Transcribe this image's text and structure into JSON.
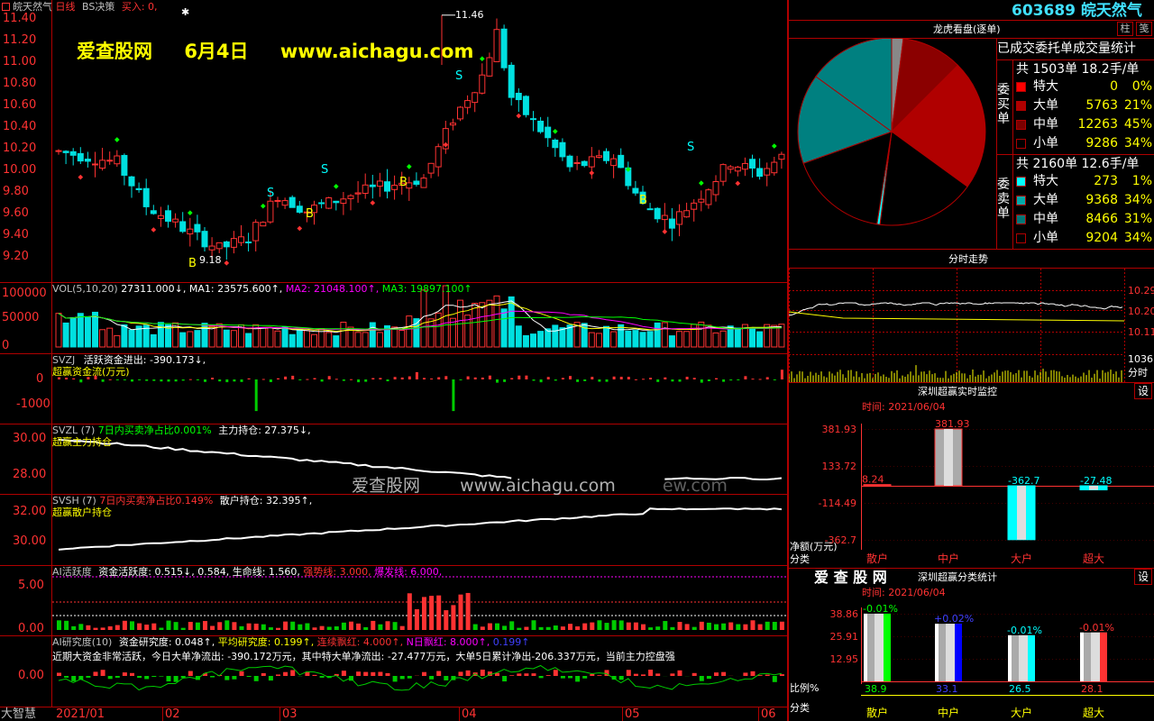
{
  "header": {
    "stock_name": "皖天然气",
    "period": "日线",
    "strategy": "BS决策",
    "signal_text": "买入: 0,",
    "code_name": "603689 皖天然气",
    "btn_zhu": "柱",
    "btn_jian": "笺"
  },
  "watermark": {
    "site": "爱查股网",
    "date": "6月4日",
    "url": "www.aichagu.com",
    "mid_site": "爱查股网",
    "mid_url": "www.aichagu.com",
    "mid_tail": "ew.com"
  },
  "price_axis": [
    "11.40",
    "11.20",
    "11.00",
    "10.80",
    "10.60",
    "10.40",
    "10.20",
    "10.00",
    "9.80",
    "9.60",
    "9.40",
    "9.20"
  ],
  "price_marks": {
    "high": "11.46",
    "low": "9.18"
  },
  "signals": {
    "s": "S",
    "b": "B"
  },
  "vol": {
    "axis": [
      "100000",
      "50000",
      "0"
    ],
    "label": "VOL(5,10,20)",
    "value": "27311.000↓,",
    "ma1": "MA1: 23575.600↑,",
    "ma2": "MA2: 21048.100↑,",
    "ma3": "MA3: 19897.100↑"
  },
  "svzj": {
    "axis": [
      "0",
      "-1000"
    ],
    "label": "SVZJ",
    "text": "活跃资金进出: -390.173↓,",
    "sub": "超赢资金流(万元)"
  },
  "svzl": {
    "axis": [
      "30.00",
      "28.00"
    ],
    "label": "SVZL (7)",
    "ratio": "7日内买卖净占比0.001%",
    "hold": "主力持仓: 27.375↓,",
    "sub": "超赢主力持仓"
  },
  "svsh": {
    "axis": [
      "32.00",
      "30.00"
    ],
    "label": "SVSH (7)",
    "ratio": "7日内买卖净占比0.149%",
    "hold": "散户持仓: 32.395↑,",
    "sub": "超赢散户持仓"
  },
  "ai_active": {
    "axis": [
      "5.00",
      "0.00"
    ],
    "label": "AI活跃度",
    "v1": "资金活跃度: 0.515↓,",
    "v2": "0.584,",
    "v3": "生命线: 1.560,",
    "v4": "强势线: 3.000,",
    "v5": "爆发线: 6.000,"
  },
  "ai_research": {
    "axis": [
      "0.00"
    ],
    "label": "AI研究度(10)",
    "v1": "资金研究度: 0.048↑,",
    "v2": "平均研究度: 0.199↑,",
    "v3": "连续飘红: 4.000↑,",
    "v4": "N日飘红: 8.000↑,",
    "v5": "0.199↑",
    "summary": "近期大资金非常活跃，今日大单净流出: -390.172万元，其中特大单净流出: -27.477万元，大单5日累计净出-206.337万元，当前主力控盘强"
  },
  "bottom": {
    "brand": "大智慧",
    "dates": [
      "2021/01",
      "02",
      "03",
      "04",
      "05",
      "06"
    ]
  },
  "longhu": {
    "title": "龙虎看盘(逐单)",
    "subtitle": "已成交委托单成交量统计",
    "buy_label": "委买单",
    "sell_label": "委卖单",
    "buy_total": "共 1503单 18.2手/单",
    "sell_total": "共 2160单 12.6手/单",
    "buy_rows": [
      {
        "name": "特大",
        "count": "0",
        "pct": "0%",
        "color": "#ff0000"
      },
      {
        "name": "大单",
        "count": "5763",
        "pct": "21%",
        "color": "#b00000"
      },
      {
        "name": "中单",
        "count": "12263",
        "pct": "45%",
        "color": "#7a0000"
      },
      {
        "name": "小单",
        "count": "9286",
        "pct": "34%",
        "color": "#000000"
      }
    ],
    "sell_rows": [
      {
        "name": "特大",
        "count": "273",
        "pct": "1%",
        "color": "#00ffff"
      },
      {
        "name": "大单",
        "count": "9368",
        "pct": "34%",
        "color": "#00aaaa"
      },
      {
        "name": "中单",
        "count": "8466",
        "pct": "31%",
        "color": "#007777"
      },
      {
        "name": "小单",
        "count": "9204",
        "pct": "34%",
        "color": "#000000"
      }
    ]
  },
  "fenshi": {
    "title": "分时走势",
    "axis": [
      "10.29",
      "10.20",
      "10.11",
      "1036",
      "分时"
    ]
  },
  "monitor": {
    "title": "深圳超赢实时监控",
    "btn": "设",
    "time": "时间: 2021/06/04",
    "axis": [
      "381.93",
      "133.72",
      "-114.49",
      "-362.7"
    ],
    "yname": "净额(万元)",
    "xname": "分类",
    "cats": [
      "散户",
      "中户",
      "大户",
      "超大"
    ],
    "values": [
      8.24,
      381.93,
      -362.7,
      -27.48
    ],
    "value_labels": [
      "8.24",
      "381.93",
      "-362.7",
      "-27.48"
    ]
  },
  "classify": {
    "brand": "爱 查 股 网",
    "title": "深圳超赢分类统计",
    "btn": "设",
    "time": "时间: 2021/06/04",
    "axis": [
      "38.86",
      "25.91",
      "12.95"
    ],
    "yname": "比例%",
    "xname": "分类",
    "cats": [
      "散户",
      "中户",
      "大户",
      "超大"
    ],
    "values": [
      38.9,
      33.1,
      26.5,
      28.1
    ],
    "value_labels": [
      "38.9",
      "33.1",
      "26.5",
      "28.1"
    ],
    "changes": [
      "-0.01%",
      "+0.02%",
      "-0.01%",
      "-0.01%"
    ]
  },
  "colors": {
    "up": "#ff3232",
    "down": "#00e0e0",
    "frame": "#b00000",
    "yellow": "#ffff00",
    "magenta": "#ff00ff",
    "green": "#00ff00"
  }
}
